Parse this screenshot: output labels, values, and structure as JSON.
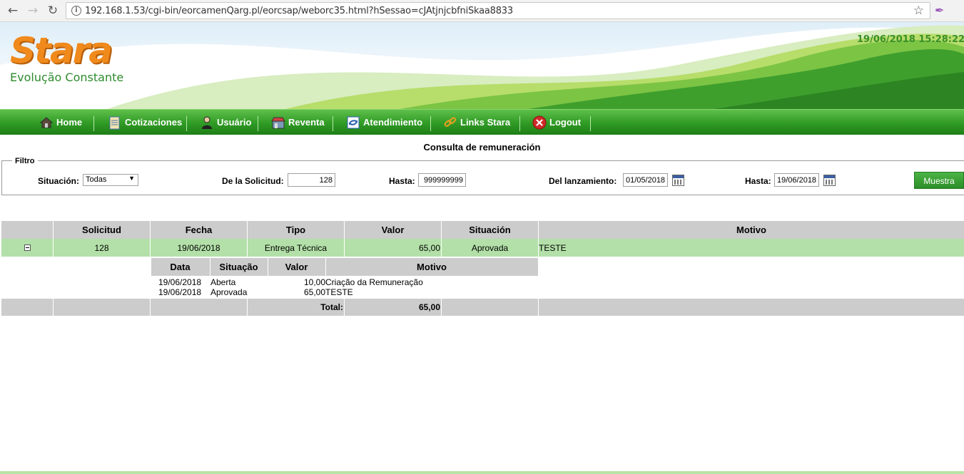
{
  "browser": {
    "url": "192.168.1.53/cgi-bin/eorcamenQarg.pl/eorcsap/weborc35.html?hSessao=cJAtjnjcbfniSkaa8833"
  },
  "header": {
    "logo": "Stara",
    "slogan": "Evolução Constante",
    "datetime": "19/06/2018  15:28:22"
  },
  "menu": {
    "items": [
      {
        "label": "Home",
        "icon": "house-icon"
      },
      {
        "label": "Cotizaciones",
        "icon": "clipboard-icon"
      },
      {
        "label": "Usuário",
        "icon": "user-icon"
      },
      {
        "label": "Reventa",
        "icon": "store-icon"
      },
      {
        "label": "Atendimiento",
        "icon": "support-icon"
      },
      {
        "label": "Links Stara",
        "icon": "link-icon"
      },
      {
        "label": "Logout",
        "icon": "logout-icon"
      }
    ]
  },
  "page": {
    "title": "Consulta de remuneración"
  },
  "filter": {
    "legend": "Filtro",
    "situacion_label": "Situación:",
    "situacion_value": "Todas",
    "solicitud_label": "De la Solicitud:",
    "solicitud_value": "128",
    "hasta1_label": "Hasta:",
    "hasta1_value": "999999999",
    "lanzamiento_label": "Del lanzamiento:",
    "lanzamiento_value": "01/05/2018",
    "hasta2_label": "Hasta:",
    "hasta2_value": "19/06/2018",
    "button_label": "Muestra"
  },
  "table": {
    "headers": [
      "",
      "Solicitud",
      "Fecha",
      "Tipo",
      "Valor",
      "Situación",
      "Motivo"
    ],
    "row": {
      "solicitud": "128",
      "fecha": "19/06/2018",
      "tipo": "Entrega Técnica",
      "valor": "65,00",
      "situacion": "Aprovada",
      "motivo": "TESTE"
    },
    "detail": {
      "headers": [
        "Data",
        "Situação",
        "Valor",
        "Motivo"
      ],
      "rows": [
        {
          "data": "19/06/2018",
          "situacao": "Aberta",
          "valor": "10,00",
          "motivo": "Criação da Remuneração"
        },
        {
          "data": "19/06/2018",
          "situacao": "Aprovada",
          "valor": "65,00",
          "motivo": "TESTE"
        }
      ]
    },
    "total_label": "Total:",
    "total_value": "65,00"
  },
  "colors": {
    "menu_green": "#2f9a25",
    "row_green": "#b3e0a8",
    "header_gray": "#cccccc",
    "logo_orange": "#f08a1c"
  }
}
